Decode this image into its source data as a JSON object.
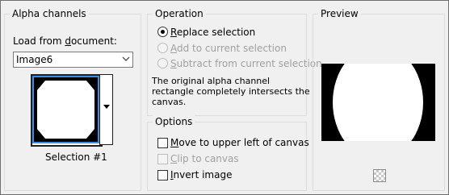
{
  "alpha_channels": {
    "title": "Alpha channels",
    "load_label_prefix": "Load from ",
    "load_label_underlined": "d",
    "load_label_suffix": "ocument:",
    "document_value": "Image6",
    "selection_caption": "Selection #1"
  },
  "operation": {
    "title": "Operation",
    "options": [
      {
        "ul": "R",
        "rest": "eplace selection",
        "selected": true,
        "enabled": true
      },
      {
        "ul": "A",
        "rest": "dd to current selection",
        "selected": false,
        "enabled": false
      },
      {
        "ul": "S",
        "rest": "ubtract from current selection",
        "selected": false,
        "enabled": false
      }
    ],
    "message_line1": "The original alpha channel",
    "message_line2": "rectangle completely intersects the",
    "message_line3": "canvas."
  },
  "options": {
    "title": "Options",
    "items": [
      {
        "ul": "M",
        "rest": "ove to upper left of canvas",
        "checked": false,
        "enabled": true
      },
      {
        "ul": "C",
        "rest": "lip to canvas",
        "checked": false,
        "enabled": false
      },
      {
        "ul": "I",
        "rest": "nvert image",
        "checked": false,
        "enabled": true
      }
    ]
  },
  "preview": {
    "title": "Preview"
  }
}
